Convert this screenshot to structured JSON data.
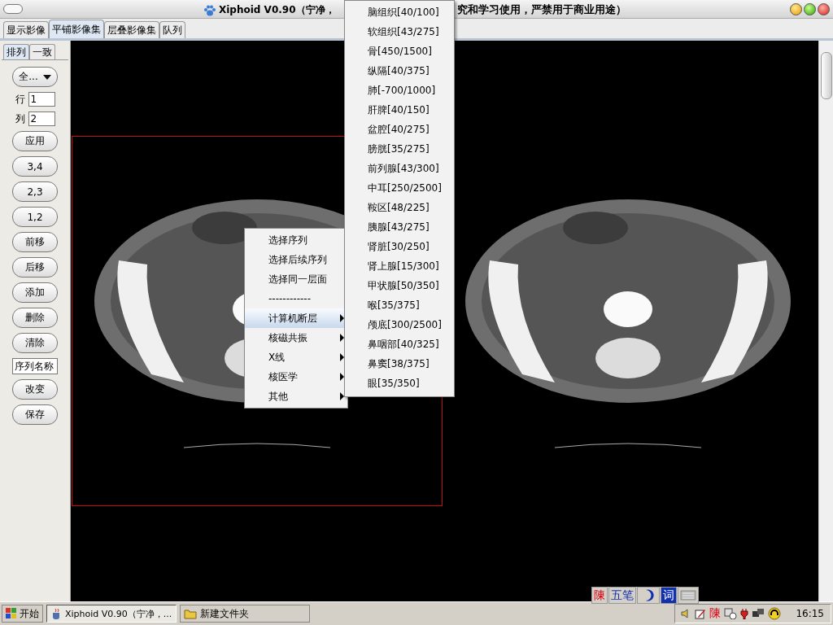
{
  "window": {
    "title_start": "Xiphoid V0.90（宁净，",
    "title_end": "究和学习使用，严禁用于商业用途）"
  },
  "tabs": [
    {
      "label": "显示影像",
      "selected": false
    },
    {
      "label": "平铺影像集",
      "selected": true
    },
    {
      "label": "层叠影像集",
      "selected": false
    },
    {
      "label": "队列",
      "selected": false
    }
  ],
  "side_tabs": [
    {
      "label": "排列",
      "selected": true
    },
    {
      "label": "一致",
      "selected": false
    }
  ],
  "controls": [
    {
      "kind": "dropdown",
      "label": "全..."
    },
    {
      "kind": "field",
      "label": "行",
      "value": "1"
    },
    {
      "kind": "field",
      "label": "列",
      "value": "2"
    },
    {
      "kind": "button",
      "label": "应用"
    },
    {
      "kind": "button",
      "label": "3,4"
    },
    {
      "kind": "button",
      "label": "2,3"
    },
    {
      "kind": "button",
      "label": "1,2"
    },
    {
      "kind": "button",
      "label": "前移"
    },
    {
      "kind": "button",
      "label": "后移"
    },
    {
      "kind": "button",
      "label": "添加"
    },
    {
      "kind": "button",
      "label": "删除"
    },
    {
      "kind": "button",
      "label": "清除"
    },
    {
      "kind": "textbox",
      "value": "序列名称"
    },
    {
      "kind": "button",
      "label": "改变"
    },
    {
      "kind": "button",
      "label": "保存"
    }
  ],
  "tiles": [
    {
      "selected": true
    },
    {
      "selected": false
    }
  ],
  "context_menu": [
    {
      "kind": "item",
      "label": "选择序列",
      "selected": false,
      "submenu": false
    },
    {
      "kind": "item",
      "label": "选择后续序列",
      "selected": false,
      "submenu": false
    },
    {
      "kind": "item",
      "label": "选择同一层面",
      "selected": false,
      "submenu": false
    },
    {
      "kind": "item",
      "label": "------------",
      "selected": false,
      "submenu": false
    },
    {
      "kind": "item",
      "label": "计算机断层",
      "selected": true,
      "submenu": true
    },
    {
      "kind": "item",
      "label": "核磁共振",
      "selected": false,
      "submenu": true
    },
    {
      "kind": "item",
      "label": "X线",
      "selected": false,
      "submenu": true
    },
    {
      "kind": "item",
      "label": "核医学",
      "selected": false,
      "submenu": true
    },
    {
      "kind": "item",
      "label": "其他",
      "selected": false,
      "submenu": true
    }
  ],
  "submenu": [
    "脑组织[40/100]",
    "软组织[43/275]",
    "骨[450/1500]",
    "纵隔[40/375]",
    "肺[-700/1000]",
    "肝脾[40/150]",
    "盆腔[40/275]",
    "膀胱[35/275]",
    "前列腺[43/300]",
    "中耳[250/2500]",
    "鞍区[48/225]",
    "胰腺[43/275]",
    "肾脏[30/250]",
    "肾上腺[15/300]",
    "甲状腺[50/350]",
    "喉[35/375]",
    "颅底[300/2500]",
    "鼻咽部[40/325]",
    "鼻窦[38/375]",
    "眼[35/350]"
  ],
  "ime_bar": {
    "name": "陳",
    "mode": "五笔",
    "word": "词"
  },
  "taskbar": {
    "start": "开始",
    "tasks": [
      {
        "label": "Xiphoid V0.90（宁净，...",
        "selected": true
      },
      {
        "label": "新建文件夹",
        "selected": false
      }
    ],
    "tray_text": "陳",
    "clock": "16:15"
  }
}
